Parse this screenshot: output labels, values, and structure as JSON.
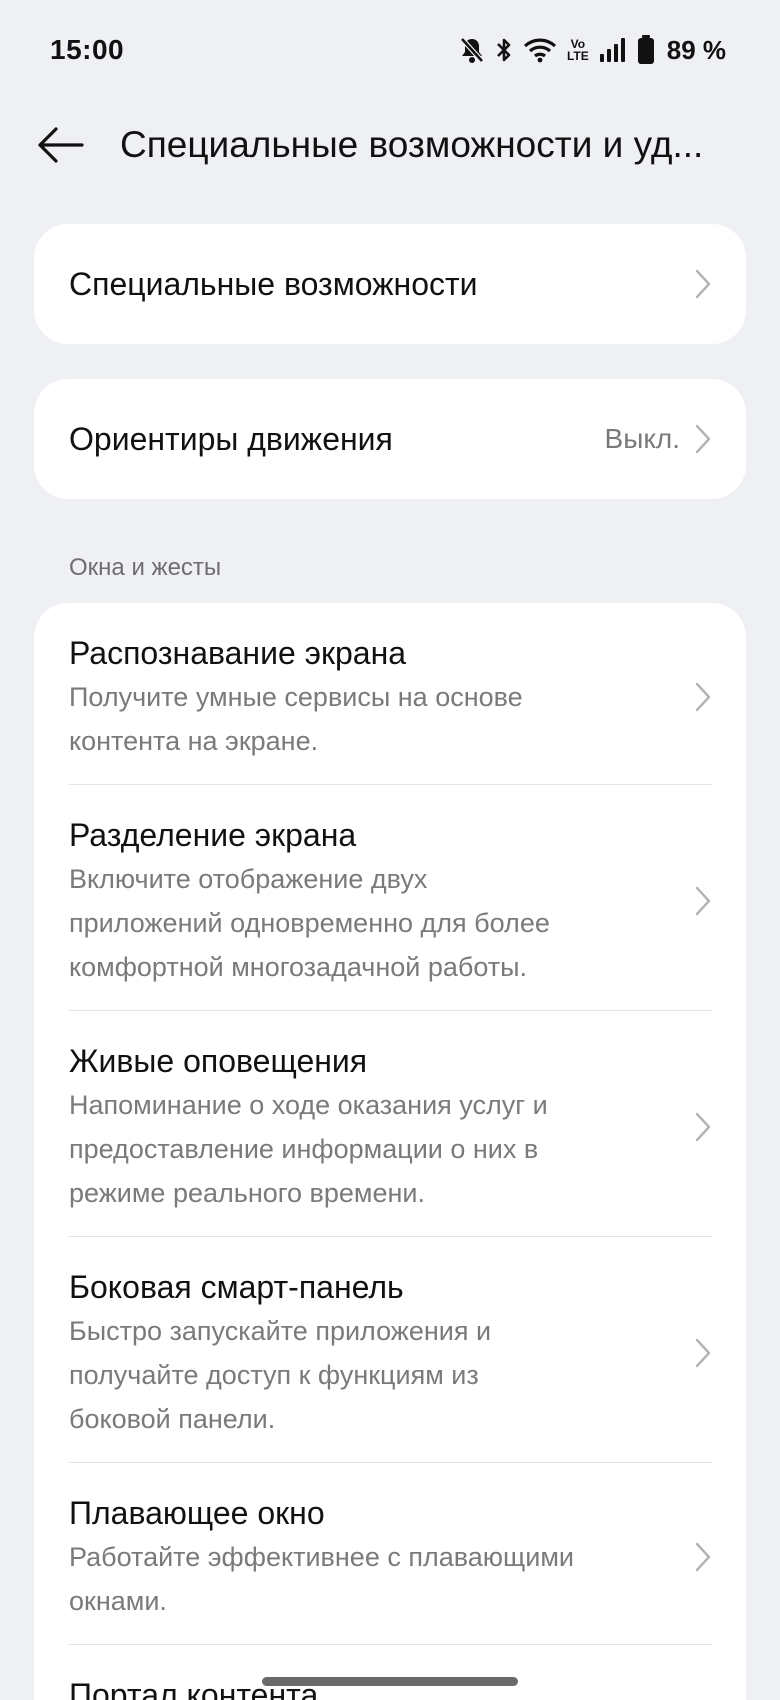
{
  "status_bar": {
    "time": "15:00",
    "volte_top": "Vo",
    "volte_bottom": "LTE",
    "battery_percent": "89 %",
    "icons": [
      "bell-muted-icon",
      "bluetooth-icon",
      "wifi-icon",
      "volte-icon",
      "signal-icon",
      "battery-icon"
    ]
  },
  "header": {
    "title": "Специальные возможности и уд...",
    "back_icon": "arrow-left-icon"
  },
  "cards": {
    "accessibility": {
      "label": "Специальные возможности"
    },
    "motion_cues": {
      "label": "Ориентиры движения",
      "value": "Выкл."
    }
  },
  "windows_section": {
    "header": "Окна и жесты",
    "items": [
      {
        "title": "Распознавание экрана",
        "desc_lines": [
          "Получите умные сервисы на основе",
          "контента на экране."
        ]
      },
      {
        "title": "Разделение экрана",
        "desc_lines": [
          "Включите отображение двух",
          "приложений одновременно для более",
          "комфортной многозадачной работы."
        ]
      },
      {
        "title": "Живые оповещения",
        "desc_lines": [
          "Напоминание о ходе оказания услуг и",
          "предоставление информации о них в",
          "режиме реального времени."
        ]
      },
      {
        "title": "Боковая смарт-панель",
        "desc_lines": [
          "Быстро запускайте приложения и",
          "получайте доступ к функциям из",
          "боковой панели."
        ]
      },
      {
        "title": "Плавающее окно",
        "desc_lines": [
          "Работайте эффективнее с плавающими",
          "окнами."
        ]
      },
      {
        "title": "Портал контента",
        "desc_lines": []
      }
    ]
  },
  "colors": {
    "background": "#eef0f3",
    "card": "#ffffff",
    "secondary_text": "#7a7a7a"
  }
}
